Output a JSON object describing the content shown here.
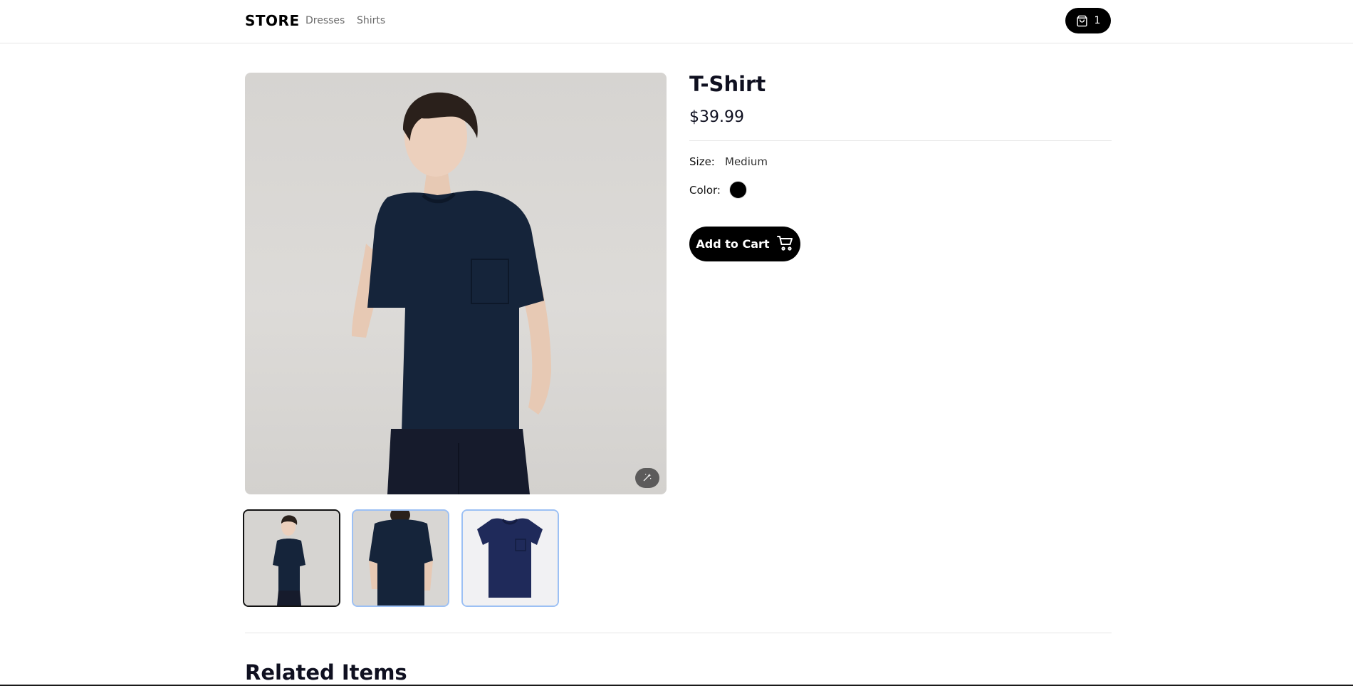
{
  "header": {
    "brand": "STORE",
    "nav": [
      {
        "label": "Dresses"
      },
      {
        "label": "Shirts"
      }
    ],
    "cart_count": "1",
    "cart_icon": "shopping-bag-icon"
  },
  "product": {
    "title": "T-Shirt",
    "price": "$39.99",
    "size_label": "Size:",
    "size_value": "Medium",
    "color_label": "Color:",
    "color_value_hex": "#000000",
    "add_to_cart_label": "Add to Cart",
    "add_to_cart_icon": "cart-icon"
  },
  "gallery": {
    "zoom_icon": "magic-wand-icon",
    "thumbnails": [
      {
        "name": "model-front",
        "active": true
      },
      {
        "name": "model-back",
        "active": false
      },
      {
        "name": "flat-tshirt",
        "active": false
      }
    ]
  },
  "related": {
    "title": "Related Items"
  },
  "colors": {
    "shirt_navy": "#15243a",
    "thumb_active_border": "#111111",
    "thumb_inactive_border": "#9cc0f4"
  }
}
